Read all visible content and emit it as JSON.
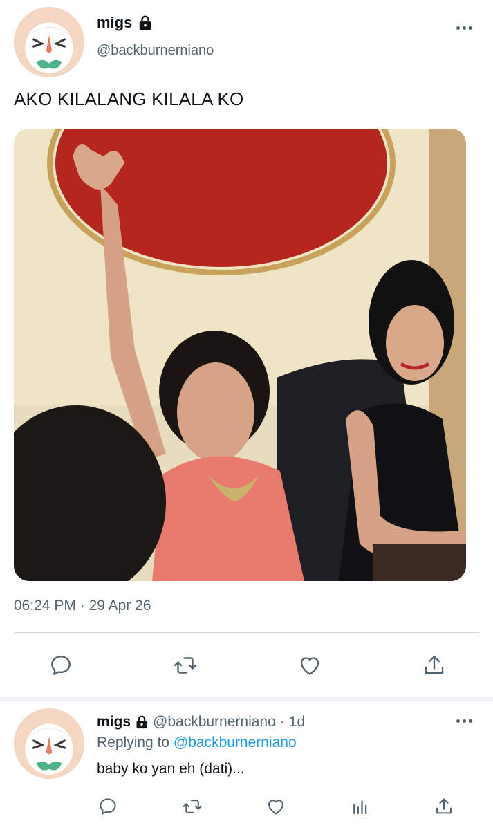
{
  "tweet": {
    "name": "migs",
    "handle": "@backburnerniano",
    "text": "AKO KILALANG KILALA KO",
    "time": "06:24 PM",
    "date_sep": " · ",
    "date": "29 Apr 26",
    "icons": {
      "lock": "lock-icon",
      "more": "more-icon",
      "reply": "reply-icon",
      "retweet": "retweet-icon",
      "like": "like-icon",
      "share": "share-icon"
    }
  },
  "reply": {
    "name": "migs",
    "handle": "@backburnerniano",
    "dot": "·",
    "age": "1d",
    "replying_label": "Replying to",
    "replying_handle": "@backburnerniano",
    "text": "baby ko yan eh (dati)...",
    "icons": {
      "reply": "reply-icon",
      "retweet": "retweet-icon",
      "like": "like-icon",
      "stats": "analytics-icon",
      "share": "share-icon"
    }
  },
  "colors": {
    "text": "#0f1419",
    "secondary": "#536471",
    "link": "#1d9bf0",
    "divider": "#cfd9de",
    "separator": "#eff3f4"
  }
}
